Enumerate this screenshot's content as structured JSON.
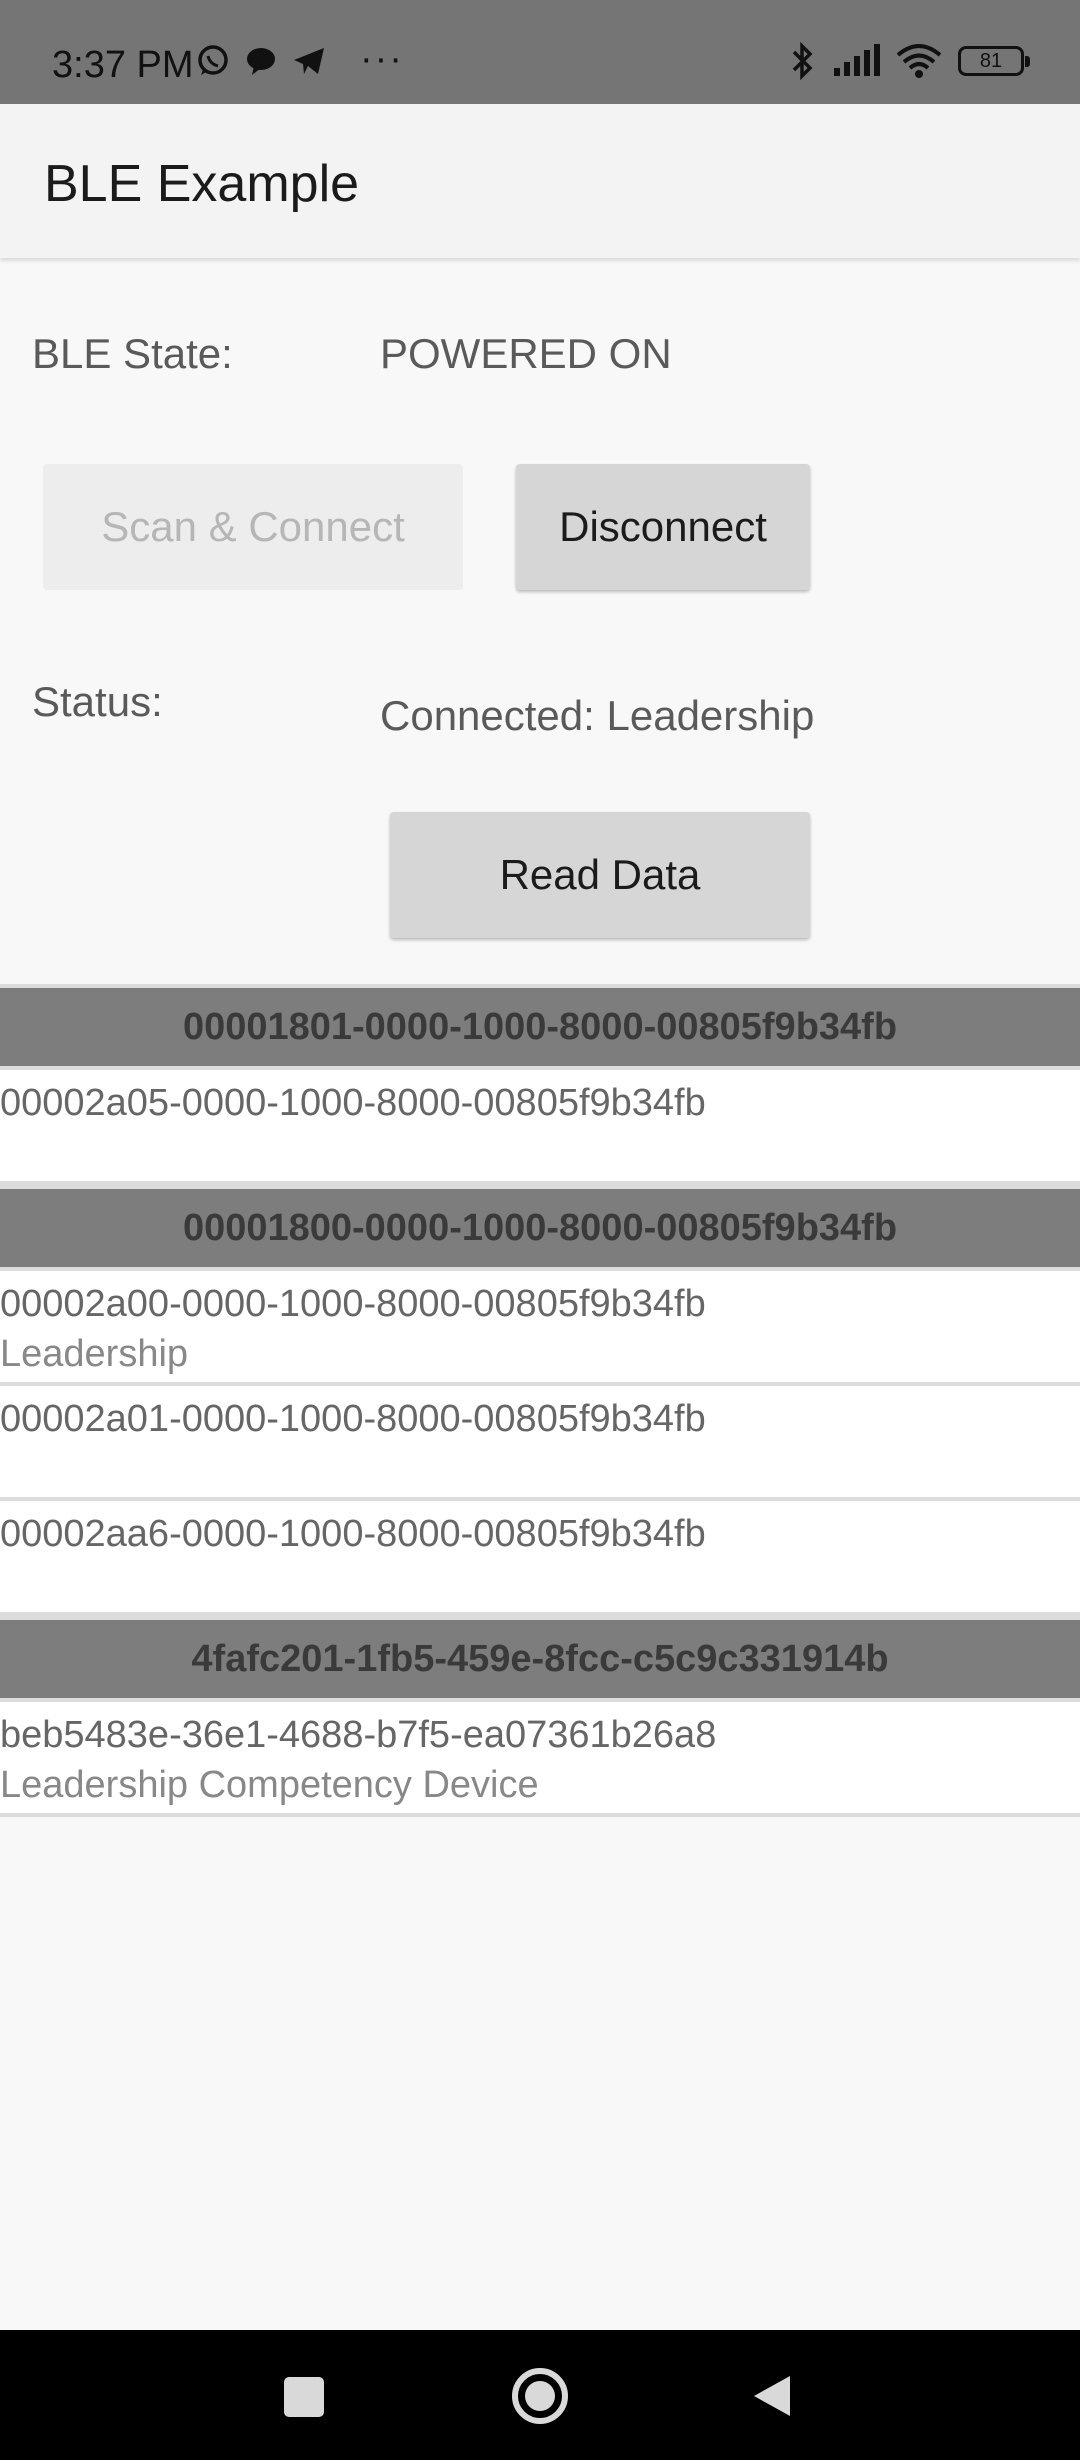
{
  "status_bar": {
    "time": "3:37 PM",
    "left_icons": [
      "whatsapp-icon",
      "chat-bubble-icon",
      "telegram-icon"
    ],
    "more": "···",
    "right_icons": [
      "bluetooth-icon",
      "signal-icon",
      "wifi-icon",
      "battery-icon"
    ],
    "battery": "81"
  },
  "app_bar": {
    "title": "BLE Example"
  },
  "ble_state": {
    "label": "BLE State:",
    "value": "POWERED ON"
  },
  "buttons": {
    "scan": "Scan & Connect",
    "disconnect": "Disconnect",
    "read": "Read Data"
  },
  "status": {
    "label": "Status:",
    "value": "Connected: Leadership"
  },
  "services": [
    {
      "uuid": "00001801-0000-1000-8000-00805f9b34fb",
      "characteristics": [
        {
          "uuid": "00002a05-0000-1000-8000-00805f9b34fb",
          "value": ""
        }
      ]
    },
    {
      "uuid": "00001800-0000-1000-8000-00805f9b34fb",
      "characteristics": [
        {
          "uuid": "00002a00-0000-1000-8000-00805f9b34fb",
          "value": "Leadership"
        },
        {
          "uuid": "00002a01-0000-1000-8000-00805f9b34fb",
          "value": ""
        },
        {
          "uuid": "00002aa6-0000-1000-8000-00805f9b34fb",
          "value": ""
        }
      ]
    },
    {
      "uuid": "4fafc201-1fb5-459e-8fcc-c5c9c331914b",
      "characteristics": [
        {
          "uuid": "beb5483e-36e1-4688-b7f5-ea07361b26a8",
          "value": "Leadership Competency Device"
        }
      ]
    }
  ],
  "nav_bar": {
    "buttons": [
      "recents-square-icon",
      "home-circle-icon",
      "back-triangle-icon"
    ]
  }
}
